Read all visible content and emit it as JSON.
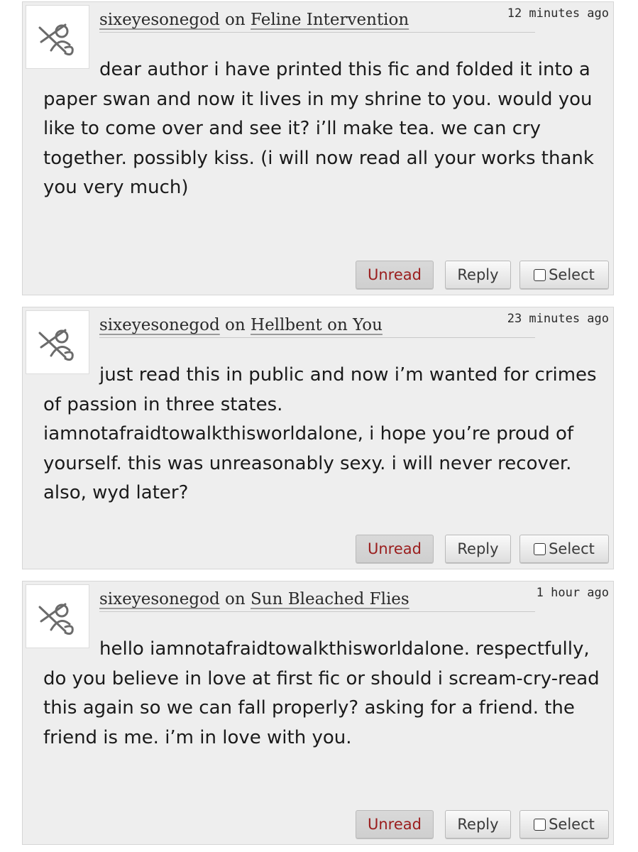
{
  "comments": [
    {
      "user": "sixeyesonegod",
      "on": "on",
      "work": "Feline Intervention",
      "time": "12 minutes ago",
      "text": "dear author i have printed this fic and folded it into a paper swan and now it lives in my shrine to you. would you like to come over and see it? i’ll make tea. we can cry together. possibly kiss. (i will now read all your works thank you very much)",
      "buttons": {
        "unread": "Unread",
        "reply": "Reply",
        "select": "Select"
      }
    },
    {
      "user": "sixeyesonegod",
      "on": "on",
      "work": "Hellbent on You",
      "time": "23 minutes ago",
      "text": "just read this in public and now i’m wanted for crimes of passion in three states. iamnotafraidtowalkthisworldalone, i hope you’re proud of yourself. this was unreasonably sexy. i will never recover. also, wyd later?",
      "buttons": {
        "unread": "Unread",
        "reply": "Reply",
        "select": "Select"
      }
    },
    {
      "user": "sixeyesonegod",
      "on": "on",
      "work": "Sun Bleached Flies",
      "time": "1 hour ago",
      "text": "hello iamnotafraidtowalkthisworldalone. respectfully, do you believe in love at first fic or should i scream-cry-read this again so we can fall properly? asking for a friend. the friend is me. i’m in love with you.",
      "buttons": {
        "unread": "Unread",
        "reply": "Reply",
        "select": "Select"
      }
    }
  ]
}
